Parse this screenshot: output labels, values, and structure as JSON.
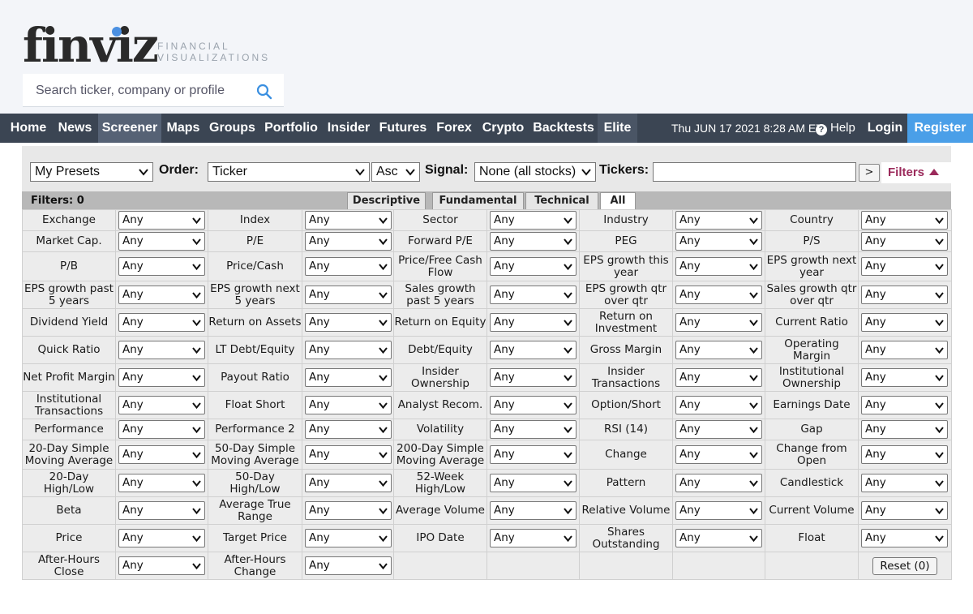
{
  "logo": {
    "word": "finviz",
    "tagline_1": "FINANCIAL",
    "tagline_2": "VISUALIZATIONS"
  },
  "search": {
    "placeholder": "Search ticker, company or profile",
    "icon": "search-icon"
  },
  "nav": {
    "items": [
      "Home",
      "News",
      "Screener",
      "Maps",
      "Groups",
      "Portfolio",
      "Insider",
      "Futures",
      "Forex",
      "Crypto",
      "Backtests",
      "Elite"
    ],
    "active": "Screener",
    "datetime": "Thu JUN 17 2021 8:28 AM ET",
    "help": "Help",
    "login": "Login",
    "register": "Register"
  },
  "controls": {
    "presets": "My Presets",
    "order_label": "Order:",
    "order_value": "Ticker",
    "direction": "Asc",
    "signal_label": "Signal:",
    "signal_value": "None (all stocks)",
    "tickers_label": "Tickers:",
    "tickers_value": "",
    "go": ">",
    "filters_toggle": "Filters"
  },
  "tabs": {
    "filters_count": "Filters: 0",
    "items": [
      "Descriptive",
      "Fundamental",
      "Technical",
      "All"
    ],
    "active": "All"
  },
  "filters": {
    "default_value": "Any",
    "rows": [
      [
        "Exchange",
        "Index",
        "Sector",
        "Industry",
        "Country"
      ],
      [
        "Market Cap.",
        "P/E",
        "Forward P/E",
        "PEG",
        "P/S"
      ],
      [
        "P/B",
        "Price/Cash",
        "Price/Free Cash Flow",
        "EPS growth this year",
        "EPS growth next year"
      ],
      [
        "EPS growth past 5 years",
        "EPS growth next 5 years",
        "Sales growth past 5 years",
        "EPS growth qtr over qtr",
        "Sales growth qtr over qtr"
      ],
      [
        "Dividend Yield",
        "Return on Assets",
        "Return on Equity",
        "Return on Investment",
        "Current Ratio"
      ],
      [
        "Quick Ratio",
        "LT Debt/Equity",
        "Debt/Equity",
        "Gross Margin",
        "Operating Margin"
      ],
      [
        "Net Profit Margin",
        "Payout Ratio",
        "Insider Ownership",
        "Insider Transactions",
        "Institutional Ownership"
      ],
      [
        "Institutional Transactions",
        "Float Short",
        "Analyst Recom.",
        "Option/Short",
        "Earnings Date"
      ],
      [
        "Performance",
        "Performance 2",
        "Volatility",
        "RSI (14)",
        "Gap"
      ],
      [
        "20-Day Simple Moving Average",
        "50-Day Simple Moving Average",
        "200-Day Simple Moving Average",
        "Change",
        "Change from Open"
      ],
      [
        "20-Day High/Low",
        "50-Day High/Low",
        "52-Week High/Low",
        "Pattern",
        "Candlestick"
      ],
      [
        "Beta",
        "Average True Range",
        "Average Volume",
        "Relative Volume",
        "Current Volume"
      ],
      [
        "Price",
        "Target Price",
        "IPO Date",
        "Shares Outstanding",
        "Float"
      ],
      [
        "After-Hours Close",
        "After-Hours Change",
        "",
        "",
        ""
      ]
    ],
    "reset": "Reset (0)"
  }
}
